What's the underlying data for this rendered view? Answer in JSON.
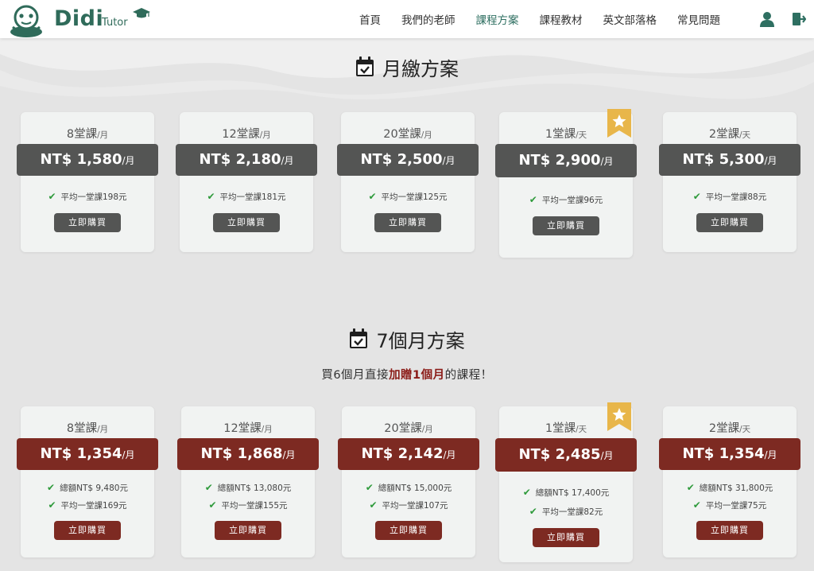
{
  "brand": {
    "name": "Didi",
    "sub": "Tutor"
  },
  "nav": {
    "items": [
      "首頁",
      "我們的老師",
      "課程方案",
      "課程教材",
      "英文部落格",
      "常見問題"
    ],
    "active_index": 2
  },
  "monthly": {
    "title": "月繳方案",
    "cards": [
      {
        "lessons": "8堂課",
        "unit": "/月",
        "price": "NT$ 1,580",
        "price_unit": "/月",
        "features": [
          "平均一堂課198元"
        ],
        "button": "立即購買"
      },
      {
        "lessons": "12堂課",
        "unit": "/月",
        "price": "NT$ 2,180",
        "price_unit": "/月",
        "features": [
          "平均一堂課181元"
        ],
        "button": "立即購買"
      },
      {
        "lessons": "20堂課",
        "unit": "/月",
        "price": "NT$ 2,500",
        "price_unit": "/月",
        "features": [
          "平均一堂課125元"
        ],
        "button": "立即購買"
      },
      {
        "lessons": "1堂課",
        "unit": "/天",
        "price": "NT$ 2,900",
        "price_unit": "/月",
        "features": [
          "平均一堂課96元"
        ],
        "button": "立即購買"
      },
      {
        "lessons": "2堂課",
        "unit": "/天",
        "price": "NT$ 5,300",
        "price_unit": "/月",
        "features": [
          "平均一堂課88元"
        ],
        "button": "立即購買"
      }
    ]
  },
  "seven_month": {
    "title": "7個月方案",
    "subtitle_pre": "買6個月直接",
    "subtitle_hl": "加贈1個月",
    "subtitle_post": "的課程！",
    "cards": [
      {
        "lessons": "8堂課",
        "unit": "/月",
        "price": "NT$ 1,354",
        "price_unit": "/月",
        "features": [
          "總額NT$ 9,480元",
          "平均一堂課169元"
        ],
        "button": "立即購買"
      },
      {
        "lessons": "12堂課",
        "unit": "/月",
        "price": "NT$ 1,868",
        "price_unit": "/月",
        "features": [
          "總額NT$ 13,080元",
          "平均一堂課155元"
        ],
        "button": "立即購買"
      },
      {
        "lessons": "20堂課",
        "unit": "/月",
        "price": "NT$ 2,142",
        "price_unit": "/月",
        "features": [
          "總額NT$ 15,000元",
          "平均一堂課107元"
        ],
        "button": "立即購買"
      },
      {
        "lessons": "1堂課",
        "unit": "/天",
        "price": "NT$ 2,485",
        "price_unit": "/月",
        "features": [
          "總額NT$ 17,400元",
          "平均一堂課82元"
        ],
        "button": "立即購買"
      },
      {
        "lessons": "2堂課",
        "unit": "/天",
        "price": "NT$ 1,354",
        "price_unit": "/月",
        "features": [
          "總額NT$ 31,800元",
          "平均一堂課75元"
        ],
        "button": "立即購買"
      }
    ]
  },
  "icons": {
    "check": "check-icon",
    "star": "star-icon",
    "calendar": "calendar-check-icon",
    "user": "user-icon",
    "logout": "logout-icon"
  },
  "colors": {
    "accent": "#2e6f61",
    "price_gray": "#545554",
    "price_red": "#7d2a22",
    "star_gold": "#e8b64a",
    "check_green": "#2e9a3b"
  }
}
